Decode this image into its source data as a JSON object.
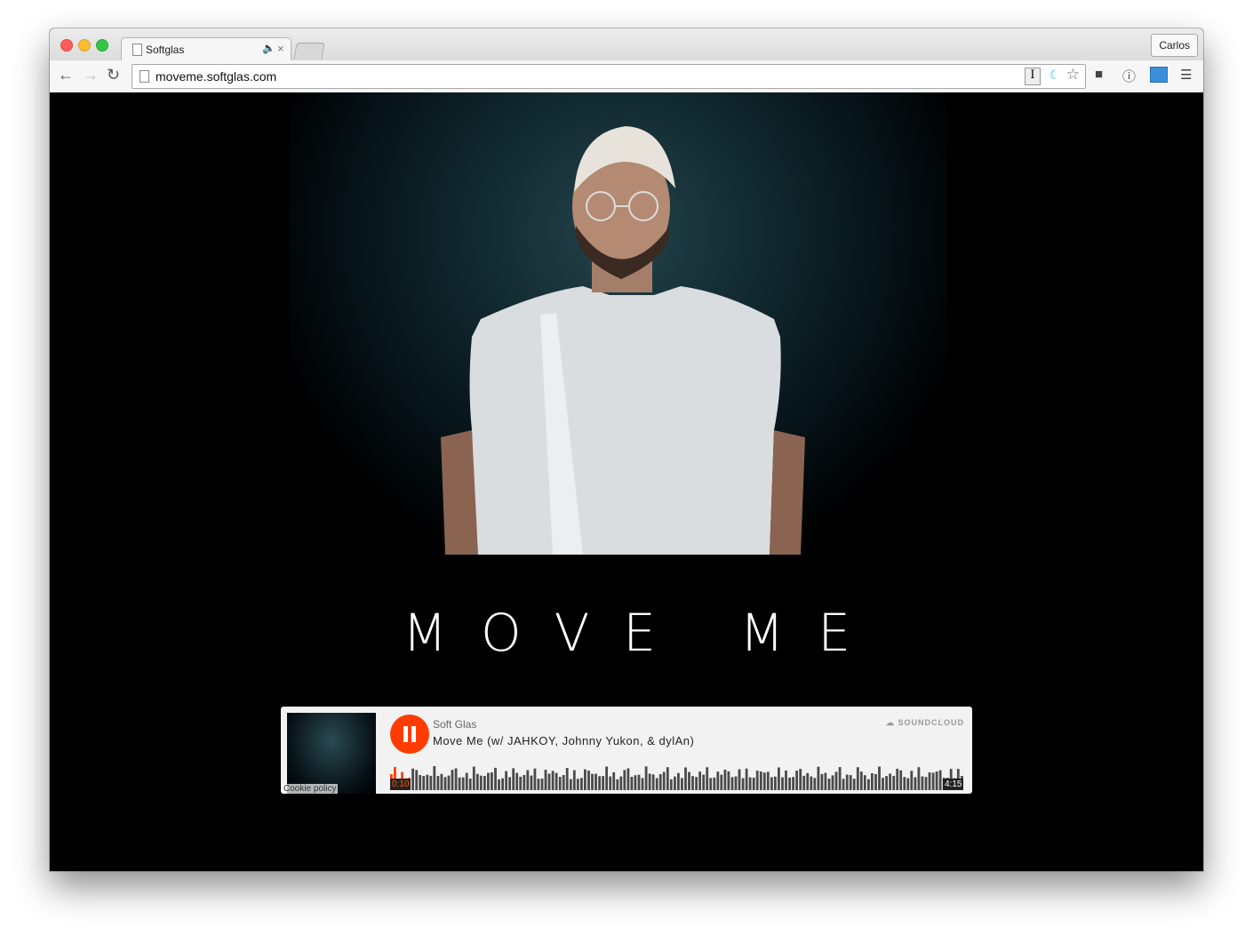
{
  "browser": {
    "tab_title": "Softglas",
    "profile_name": "Carlos",
    "url": "moveme.softglas.com",
    "tab_audio_icon": "speaker-icon",
    "close_glyph": "×"
  },
  "page": {
    "headline": "MOVE ME"
  },
  "player": {
    "artist": "Soft Glas",
    "track_title": "Move Me (w/ JAHKOY, Johnny Yukon, & dylAn)",
    "brand": "SOUNDCLOUD",
    "elapsed": "0:10",
    "duration": "4:15",
    "cookie_policy": "Cookie policy",
    "state": "playing",
    "progress_fraction": 0.04,
    "accent_color": "#ff3c00"
  }
}
